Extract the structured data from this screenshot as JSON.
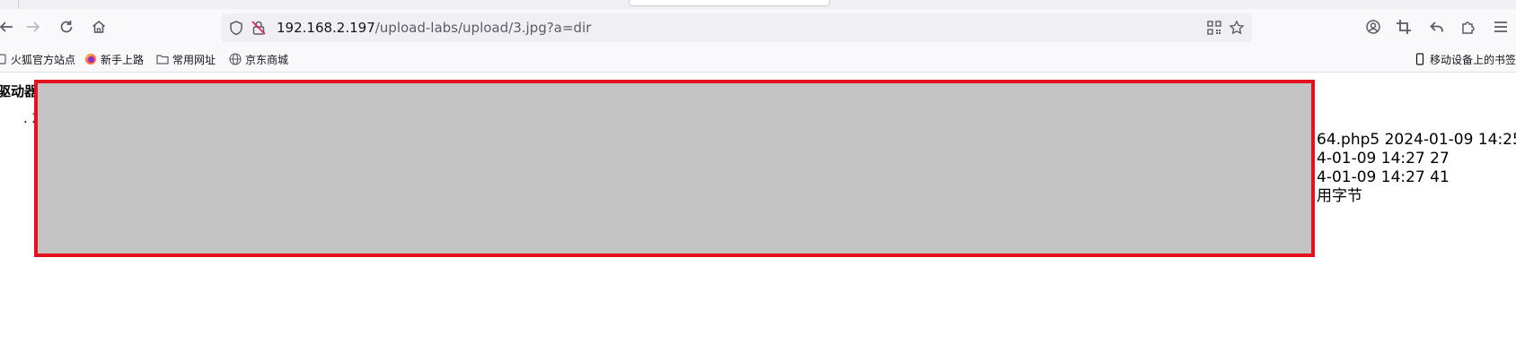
{
  "browser": {
    "url_host": "192.168.2.197",
    "url_path": "/upload-labs/upload/3.jpg?a=dir",
    "bookmarks": [
      "火狐官方站点",
      "新手上路",
      "常用网址",
      "京东商城"
    ],
    "mobile_bookmarks": "移动设备上的书签"
  },
  "page": {
    "heading_fragment": "驱动器",
    "list_fragment": ". 2",
    "lines": [
      "64.php5 2024-01-09 14:25",
      "4-01-09 14:27 27",
      "4-01-09 14:27 41",
      "用字节"
    ]
  },
  "colors": {
    "redact_border": "#e3121d",
    "redact_fill": "#c3c3c3"
  }
}
